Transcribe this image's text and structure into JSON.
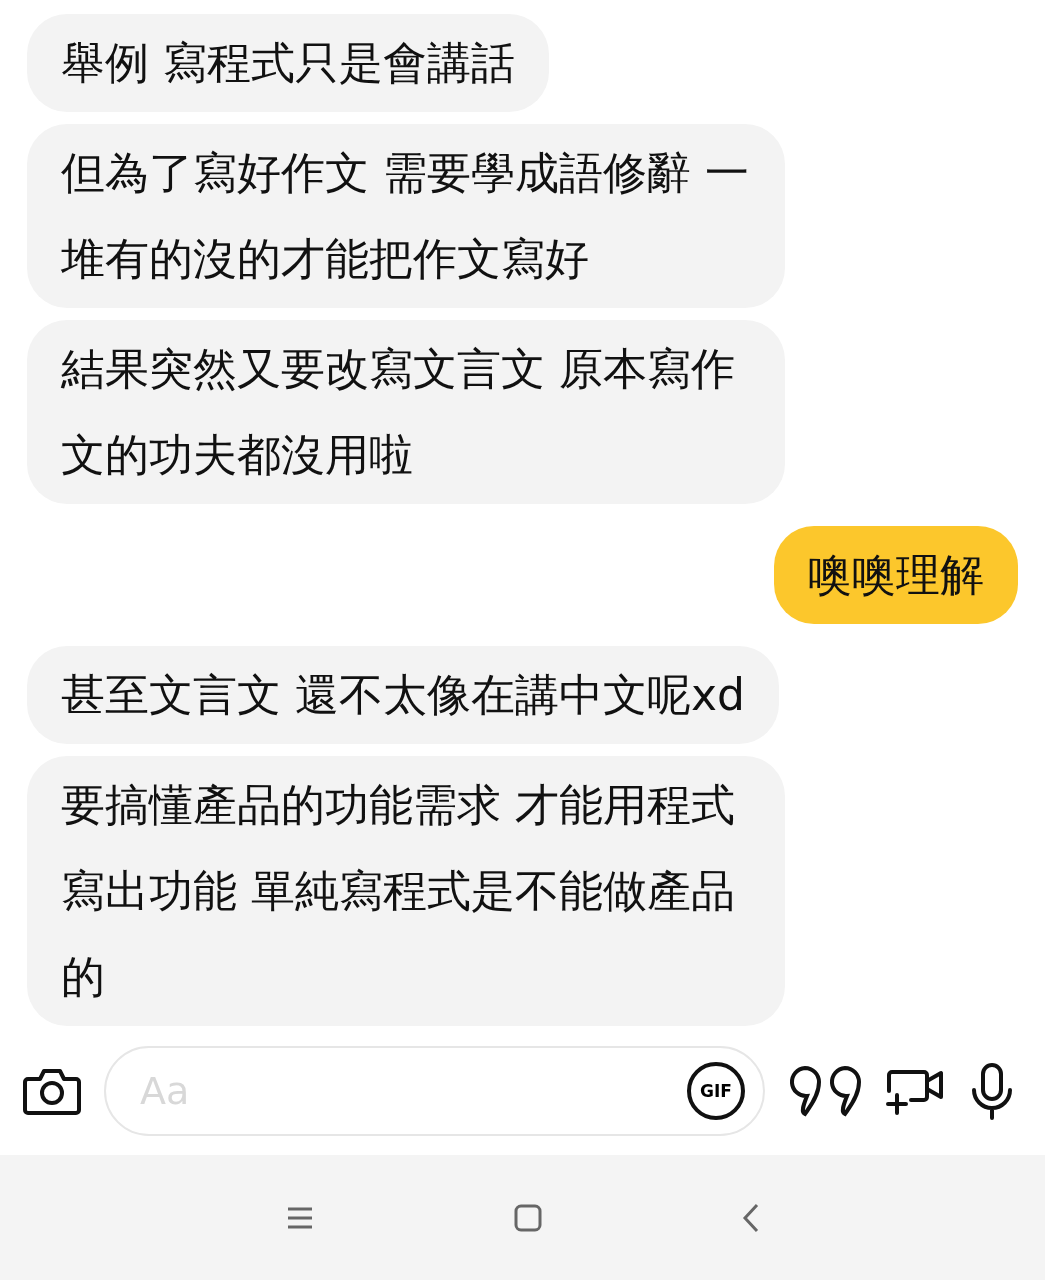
{
  "messages": [
    {
      "kind": "incoming",
      "text": "舉例 寫程式只是會講話"
    },
    {
      "kind": "incoming",
      "text": "但為了寫好作文 需要學成語修辭 一堆有的沒的才能把作文寫好"
    },
    {
      "kind": "incoming",
      "text": "結果突然又要改寫文言文 原本寫作文的功夫都沒用啦"
    },
    {
      "kind": "outgoing",
      "text": "噢噢理解"
    },
    {
      "kind": "incoming",
      "text": "甚至文言文 還不太像在講中文呢xd"
    },
    {
      "kind": "incoming",
      "text": "要搞懂產品的功能需求 才能用程式寫出功能 單純寫程式是不能做產品的"
    }
  ],
  "composer": {
    "placeholder": "Aa",
    "gif_label": "GIF"
  }
}
